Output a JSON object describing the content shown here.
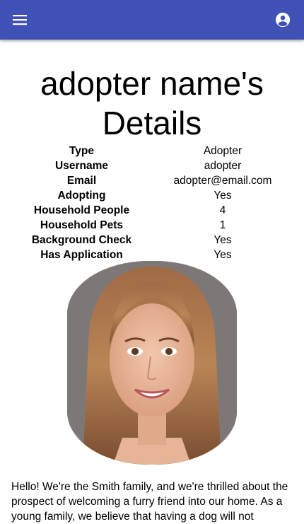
{
  "appbar": {
    "menu_icon": "hamburger-menu-icon",
    "account_icon": "account-circle-icon",
    "color": "#3f51b5"
  },
  "page": {
    "title": "adopter name's Details"
  },
  "details": [
    {
      "label": "Type",
      "value": "Adopter"
    },
    {
      "label": "Username",
      "value": "adopter"
    },
    {
      "label": "Email",
      "value": "adopter@email.com"
    },
    {
      "label": "Adopting",
      "value": "Yes"
    },
    {
      "label": "Household People",
      "value": "4"
    },
    {
      "label": "Household Pets",
      "value": "1"
    },
    {
      "label": "Background Check",
      "value": "Yes"
    },
    {
      "label": "Has Application",
      "value": "Yes"
    }
  ],
  "bio": "Hello! We're the Smith family, and we're thrilled about the prospect of welcoming a furry friend into our home. As a young family, we believe that having a dog will not"
}
